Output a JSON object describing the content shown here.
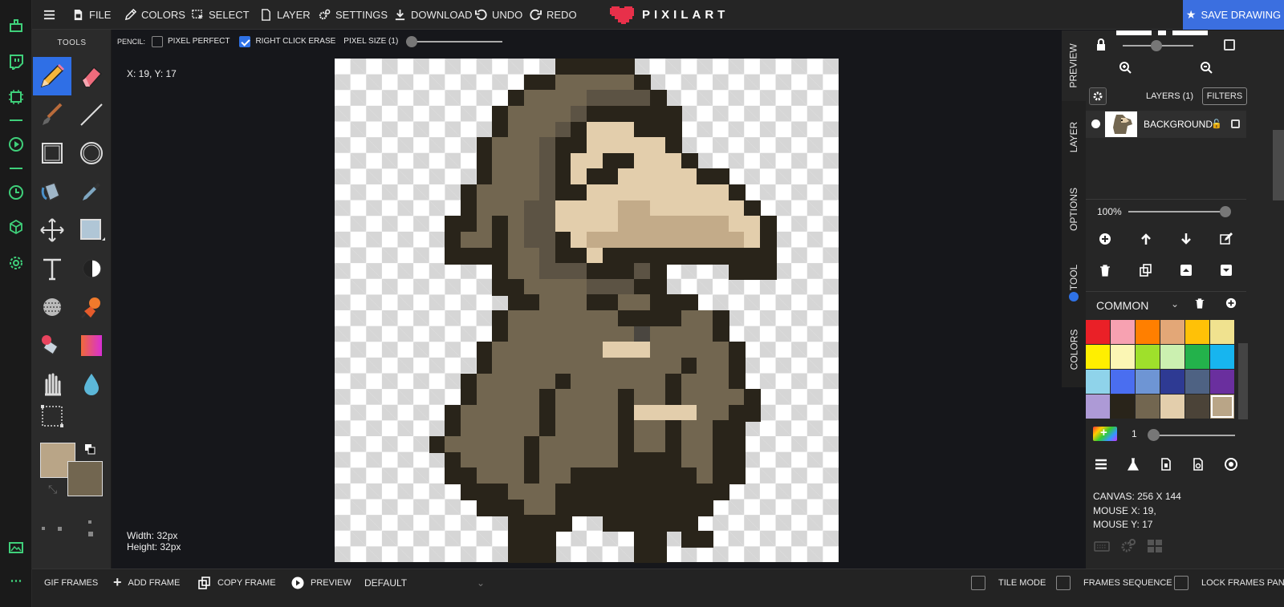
{
  "topbar": {
    "menu_label": "menu",
    "file": "FILE",
    "colors": "COLORS",
    "select": "SELECT",
    "layer": "LAYER",
    "settings": "SETTINGS",
    "download": "DOWNLOAD",
    "undo": "UNDO",
    "redo": "REDO",
    "brand": "PIXILART",
    "save": "SAVE DRAWING"
  },
  "tools": {
    "title": "TOOLS",
    "primary_color": "#b9a587",
    "secondary_color": "#726650"
  },
  "options": {
    "tool_name": "PENCIL:",
    "pixel_perfect": "PIXEL PERFECT",
    "pixel_perfect_checked": false,
    "right_click_erase": "RIGHT CLICK ERASE",
    "right_click_erase_checked": true,
    "pixel_size": "PIXEL SIZE (1)"
  },
  "canvas": {
    "coords": "X: 19, Y: 17",
    "width": "Width: 32px",
    "height": "Height: 32px"
  },
  "side_tabs": [
    "PREVIEW",
    "LAYER",
    "OPTIONS",
    "TOOL",
    "COLORS"
  ],
  "layers": {
    "title": "LAYERS (1)",
    "filters": "FILTERS",
    "layer_name": "BACKGROUND",
    "opacity": "100%"
  },
  "palette": {
    "name": "COMMON",
    "colors": [
      "#ea2027",
      "#f7a1b1",
      "#ff7f00",
      "#e3a777",
      "#ffc107",
      "#f0e28f",
      "#ffef00",
      "#fbf6b4",
      "#9fe02b",
      "#cbf0b0",
      "#23b24b",
      "#17b5ef",
      "#8fd3ea",
      "#4a6ef0",
      "#6e95d4",
      "#2e3a93",
      "#4e6283",
      "#6a2f9e",
      "#ad9ad6",
      "#29241a",
      "#726650",
      "#e3ceac",
      "#4b4338",
      "#b9a587"
    ],
    "selected_index": 23,
    "brush_size": "1"
  },
  "info": {
    "canvas": "CANVAS: 256 X 144",
    "mouse_x": "MOUSE X: 19,",
    "mouse_y": "MOUSE Y: 17"
  },
  "bottom": {
    "gif_frames": "GIF FRAMES",
    "add_frame": "ADD FRAME",
    "copy_frame": "COPY FRAME",
    "preview": "PREVIEW",
    "default": "DEFAULT",
    "tile_mode": "TILE MODE",
    "frames_sequence": "FRAMES SEQUENCE",
    "lock_frames_panel": "LOCK FRAMES PANEL"
  },
  "sprite_colors": {
    "dark": "#29241a",
    "robe": "#726650",
    "robe_shadow": "#5c5344",
    "mask": "#e3ceac",
    "mask_shadow": "#c3ab89",
    "grey": "#4a4640"
  }
}
